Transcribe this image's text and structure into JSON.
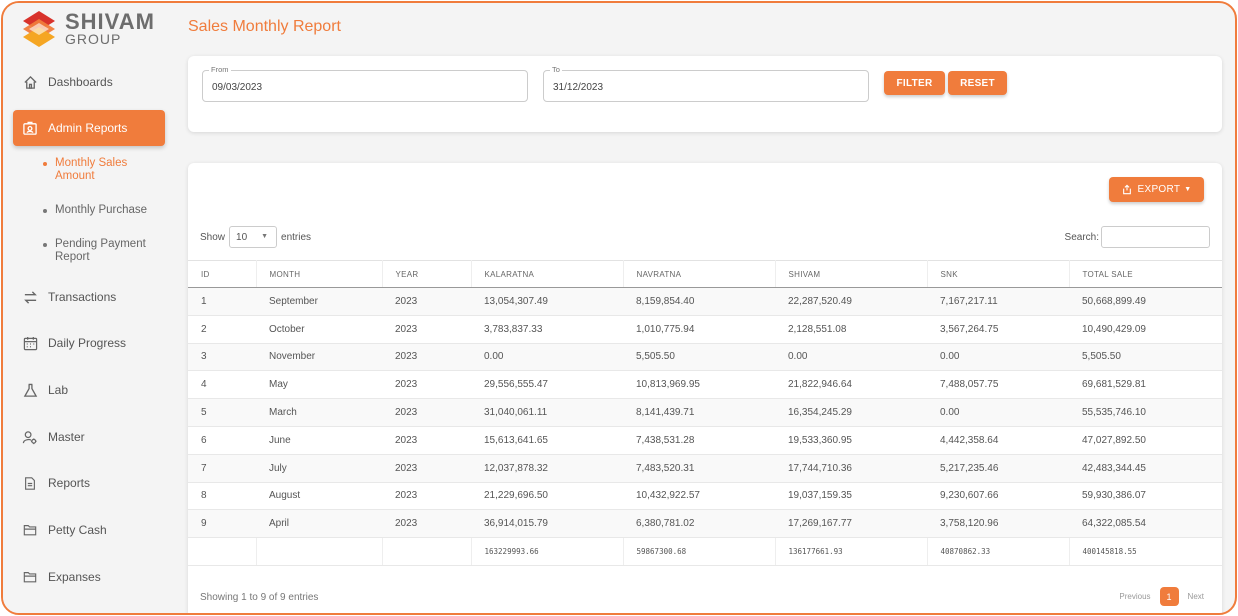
{
  "brand": {
    "name_line1": "SHIVAM",
    "name_line2": "GROUP",
    "color": "#f07c3c"
  },
  "sidebar": {
    "items": [
      {
        "label": "Dashboards",
        "icon": "home-icon"
      },
      {
        "label": "Admin Reports",
        "icon": "report-id-icon",
        "active": true
      },
      {
        "label": "Transactions",
        "icon": "swap-arrows-icon"
      },
      {
        "label": "Daily Progress",
        "icon": "calendar-icon"
      },
      {
        "label": "Lab",
        "icon": "flask-icon"
      },
      {
        "label": "Master",
        "icon": "user-gear-icon"
      },
      {
        "label": "Reports",
        "icon": "document-icon"
      },
      {
        "label": "Petty Cash",
        "icon": "folder-icon"
      },
      {
        "label": "Expanses",
        "icon": "folder-icon"
      }
    ],
    "sub_items": [
      {
        "label": "Monthly Sales Amount",
        "active": true
      },
      {
        "label": "Monthly Purchase"
      },
      {
        "label": "Pending Payment Report"
      }
    ]
  },
  "page": {
    "title": "Sales Monthly Report"
  },
  "filter": {
    "from_label": "From",
    "from_value": "09/03/2023",
    "to_label": "To",
    "to_value": "31/12/2023",
    "filter_label": "FILTER",
    "reset_label": "RESET"
  },
  "table": {
    "export_label": "EXPORT",
    "show_label": "Show",
    "entries_value": "10",
    "entries_label": "entries",
    "search_label": "Search:",
    "columns": [
      "ID",
      "MONTH",
      "YEAR",
      "KALARATNA",
      "NAVRATNA",
      "SHIVAM",
      "SNK",
      "TOTAL SALE"
    ],
    "rows": [
      [
        "1",
        "September",
        "2023",
        "13,054,307.49",
        "8,159,854.40",
        "22,287,520.49",
        "7,167,217.11",
        "50,668,899.49"
      ],
      [
        "2",
        "October",
        "2023",
        "3,783,837.33",
        "1,010,775.94",
        "2,128,551.08",
        "3,567,264.75",
        "10,490,429.09"
      ],
      [
        "3",
        "November",
        "2023",
        "0.00",
        "5,505.50",
        "0.00",
        "0.00",
        "5,505.50"
      ],
      [
        "4",
        "May",
        "2023",
        "29,556,555.47",
        "10,813,969.95",
        "21,822,946.64",
        "7,488,057.75",
        "69,681,529.81"
      ],
      [
        "5",
        "March",
        "2023",
        "31,040,061.11",
        "8,141,439.71",
        "16,354,245.29",
        "0.00",
        "55,535,746.10"
      ],
      [
        "6",
        "June",
        "2023",
        "15,613,641.65",
        "7,438,531.28",
        "19,533,360.95",
        "4,442,358.64",
        "47,027,892.50"
      ],
      [
        "7",
        "July",
        "2023",
        "12,037,878.32",
        "7,483,520.31",
        "17,744,710.36",
        "5,217,235.46",
        "42,483,344.45"
      ],
      [
        "8",
        "August",
        "2023",
        "21,229,696.50",
        "10,432,922.57",
        "19,037,159.35",
        "9,230,607.66",
        "59,930,386.07"
      ],
      [
        "9",
        "April",
        "2023",
        "36,914,015.79",
        "6,380,781.02",
        "17,269,167.77",
        "3,758,120.96",
        "64,322,085.54"
      ]
    ],
    "totals": [
      "",
      "",
      "",
      "163229993.66",
      "59867300.68",
      "136177661.93",
      "40870862.33",
      "400145818.55"
    ],
    "info": "Showing 1 to 9 of 9 entries",
    "pager": {
      "previous": "Previous",
      "current": "1",
      "next": "Next"
    }
  }
}
